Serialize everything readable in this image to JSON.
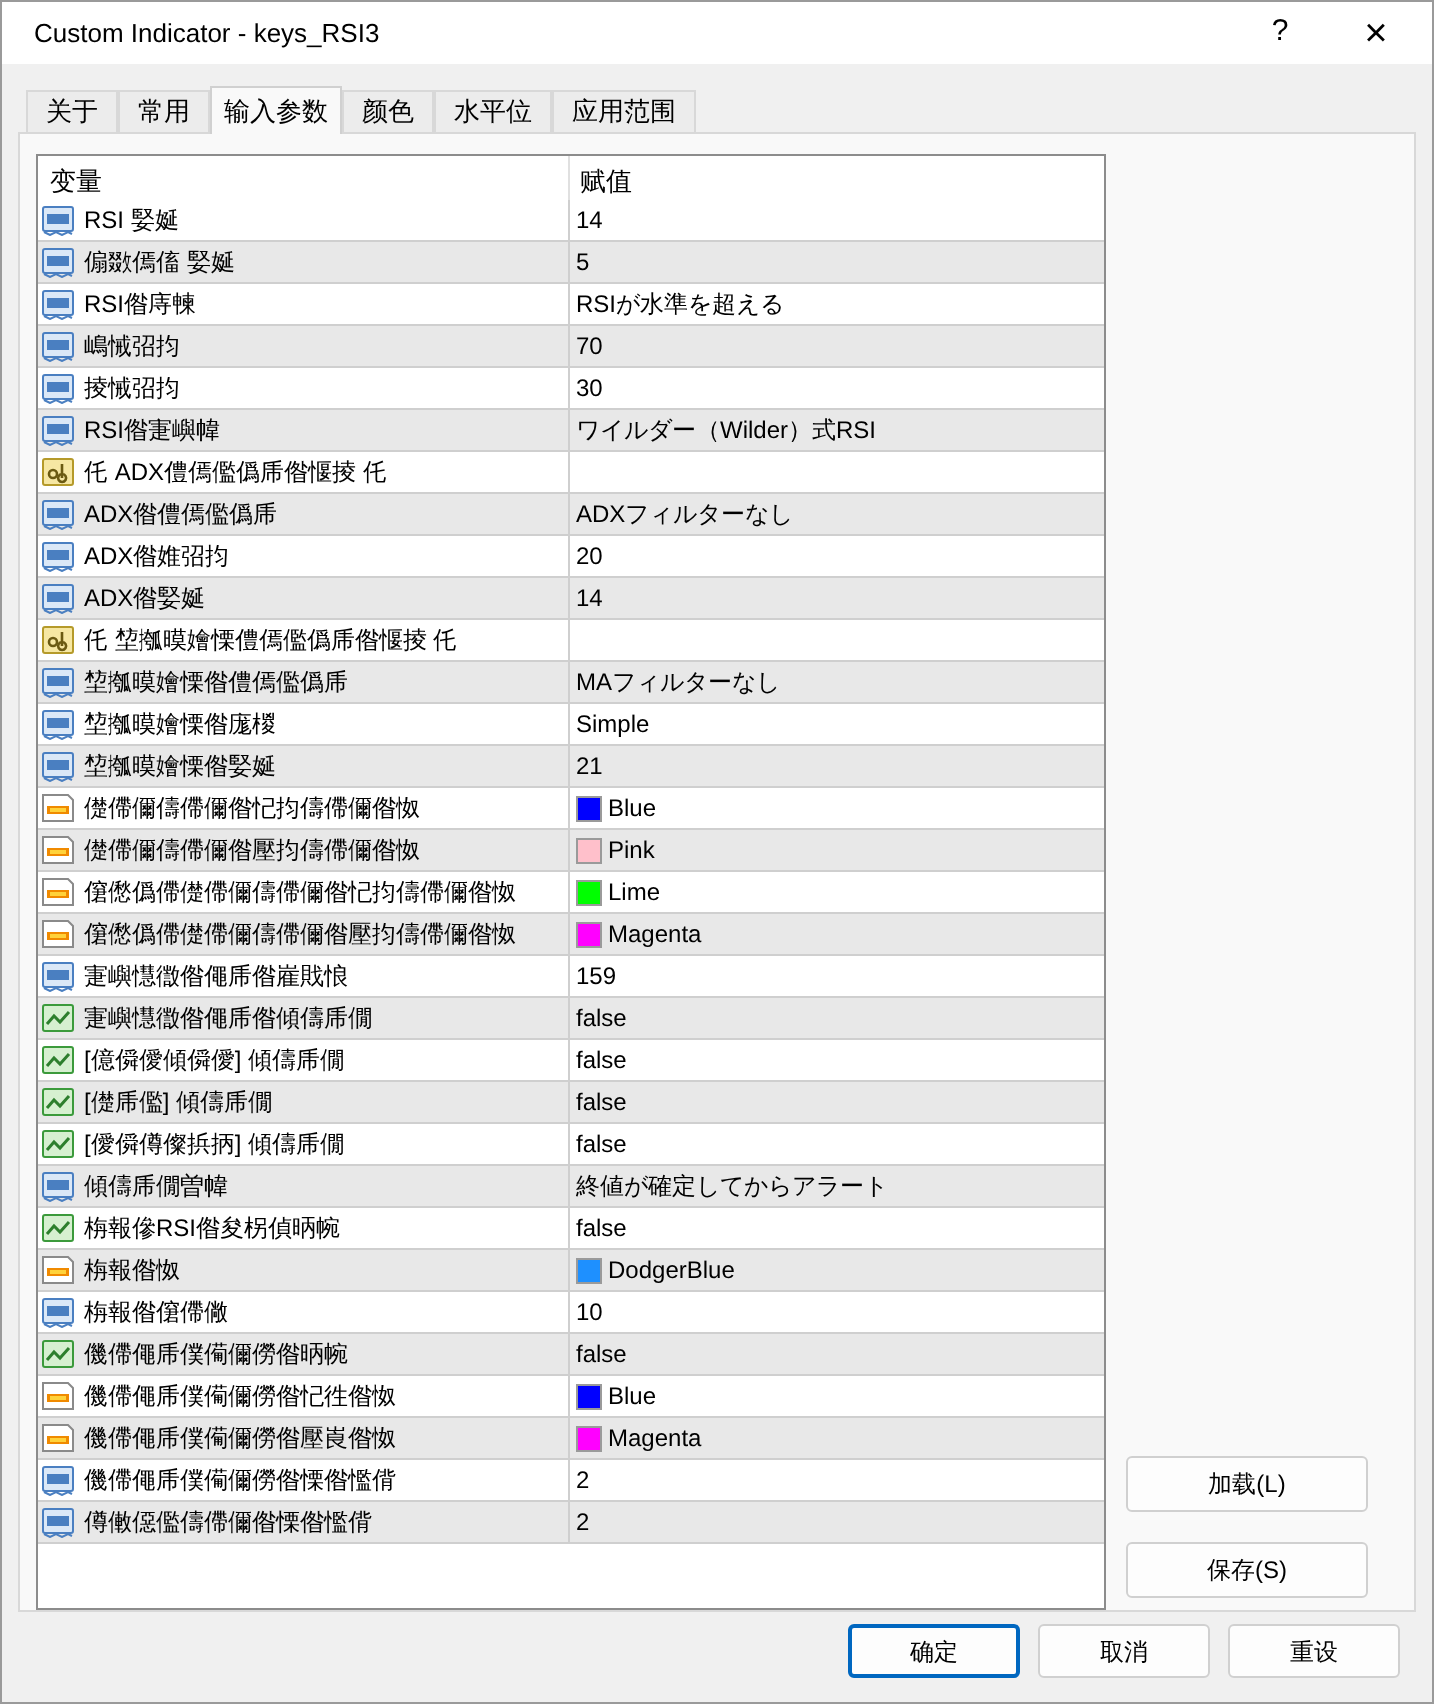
{
  "window": {
    "title": "Custom Indicator - keys_RSI3",
    "help": "?",
    "close": "×"
  },
  "tabs": [
    {
      "label": "关于",
      "selected": false
    },
    {
      "label": "常用",
      "selected": false
    },
    {
      "label": "输入参数",
      "selected": true
    },
    {
      "label": "颜色",
      "selected": false
    },
    {
      "label": "水平位",
      "selected": false
    },
    {
      "label": "应用范围",
      "selected": false
    }
  ],
  "table": {
    "columns": [
      "变量",
      "赋值"
    ],
    "rows": [
      {
        "kind": "int",
        "name": "RSI 婜娫",
        "value": "14"
      },
      {
        "kind": "int",
        "name": "傓敪傿傗 婜娫",
        "value": "5"
      },
      {
        "kind": "int",
        "name": "RSI偺庤朄",
        "value": "RSIが水準を超える"
      },
      {
        "kind": "int",
        "name": "嶋悈弨抣",
        "value": "70"
      },
      {
        "kind": "int",
        "name": "掕悈弨抣",
        "value": "30"
      },
      {
        "kind": "int",
        "name": "RSI偺寁嶼幃",
        "value": "ワイルダー（Wilder）式RSI"
      },
      {
        "kind": "string",
        "name": "仛 ADX僼傿儖僞乕偺愝掕 仛"
      },
      {
        "kind": "int",
        "name": "ADX偺僼傿儖僞乕",
        "value": "ADXフィルターなし"
      },
      {
        "kind": "int",
        "name": "ADX偺婎弨抣",
        "value": "20"
      },
      {
        "kind": "int",
        "name": "ADX偺婜娫",
        "value": "14"
      },
      {
        "kind": "string",
        "name": "仛 堏摦暯嬒慄僼傿儖僞乕偺愝掕 仛"
      },
      {
        "kind": "int",
        "name": "堏摦暯嬒慄偺僼傿儖僞乕",
        "value": "MAフィルターなし"
      },
      {
        "kind": "int",
        "name": "堏摦暯嬒慄偺庬椶",
        "value": "Simple"
      },
      {
        "kind": "int",
        "name": "堏摦暯嬒慄偺婜娫",
        "value": "21"
      },
      {
        "kind": "color",
        "name": "儊僀儞儔僀儞偺忋抣儔僀儞偺怓",
        "value": "Blue",
        "color": "#0000ff"
      },
      {
        "kind": "color",
        "name": "儊僀儞儔僀儞偺壓抣儔僀儞偺怓",
        "value": "Pink",
        "color": "#ffc0cb"
      },
      {
        "kind": "color",
        "name": "僒僽僞僀儊僀儞儔僀儞偺忋抣儔僀儞偺怓",
        "value": "Lime",
        "color": "#00ff00"
      },
      {
        "kind": "color",
        "name": "僒僽僞僀儊僀儞儔僀儞偺壓抣儔僀儞偺怓",
        "value": "Magenta",
        "color": "#ff00ff"
      },
      {
        "kind": "int",
        "name": "寁嶼懳徾偺僶乕偺嵟戝悢",
        "value": "159"
      },
      {
        "kind": "bool",
        "name": "寁嶼懳徾偺僶乕偺傾儔乕僩",
        "value": "false"
      },
      {
        "kind": "bool",
        "name": "[億僢僾傾僢僾] 傾儔乕僩",
        "value": "false"
      },
      {
        "kind": "bool",
        "name": "[儊乕儖] 傾儔乕僩",
        "value": "false"
      },
      {
        "kind": "bool",
        "name": "[僾僢僔儏捠抦] 傾儔乕僩",
        "value": "false"
      },
      {
        "kind": "int",
        "name": "傾儔乕僩曽幃",
        "value": "終値が確定してからアラート"
      },
      {
        "kind": "bool",
        "name": "栴報傪RSI偺夋柺偵昞帵",
        "value": "false"
      },
      {
        "kind": "color",
        "name": "栴報偺怓",
        "value": "DodgerBlue",
        "color": "#1e90ff"
      },
      {
        "kind": "int",
        "name": "栴報偺僒僀僘",
        "value": "10"
      },
      {
        "kind": "bool",
        "name": "僟僀僶乕僕僃儞僗偺昞帵",
        "value": "false"
      },
      {
        "kind": "color",
        "name": "僟僀僶乕僕僃儞僗偺忋徃偺怓",
        "value": "Blue",
        "color": "#0000ff"
      },
      {
        "kind": "color",
        "name": "僟僀僶乕僕僃儞僗偺壓崀偺怓",
        "value": "Magenta",
        "color": "#ff00ff"
      },
      {
        "kind": "int",
        "name": "僟僀僶乕僕僃儞僗偺慄偺懢偝",
        "value": "2"
      },
      {
        "kind": "int",
        "name": "僔僌僫儖儔僀儞偺慄偺懢偝",
        "value": "2"
      }
    ]
  },
  "side_buttons": [
    "加载(L)",
    "保存(S)"
  ],
  "buttons": [
    {
      "label": "确定",
      "default": true
    },
    {
      "label": "取消",
      "default": false
    },
    {
      "label": "重设",
      "default": false
    }
  ]
}
